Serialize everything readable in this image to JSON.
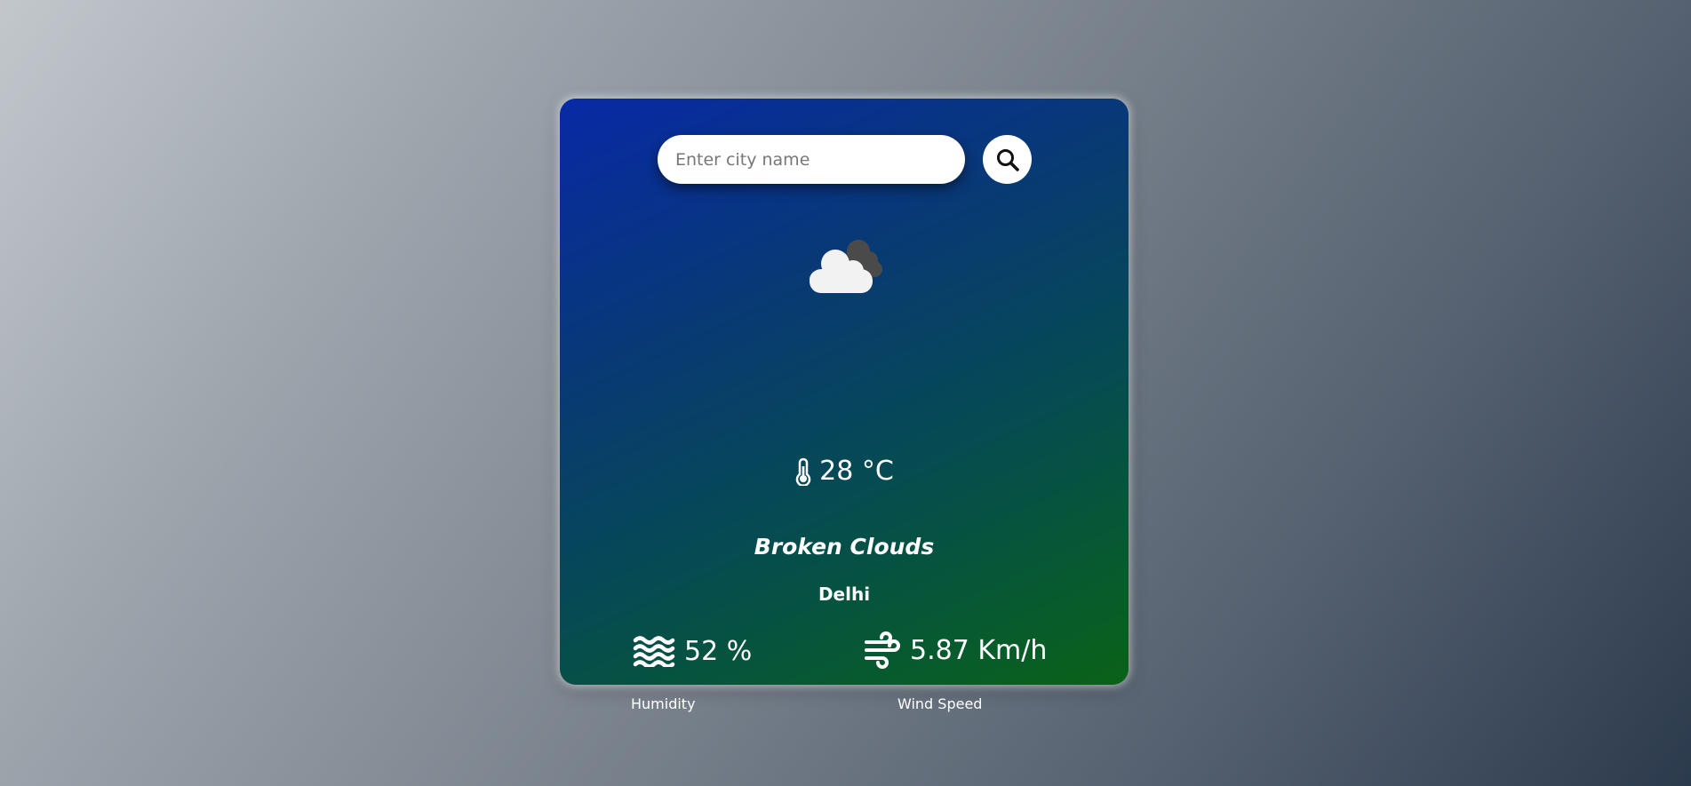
{
  "search": {
    "placeholder": "Enter city name",
    "button_icon": "search-icon"
  },
  "weather": {
    "icon": "broken-clouds-icon",
    "temperature": "28 °C",
    "temperature_icon": "thermometer-icon",
    "description": "Broken Clouds",
    "city": "Delhi"
  },
  "stats": {
    "humidity": {
      "value": "52 %",
      "label": "Humidity",
      "icon": "water-waves-icon"
    },
    "wind": {
      "value": "5.87 Km/h",
      "label": "Wind Speed",
      "icon": "wind-icon"
    }
  },
  "colors": {
    "card_gradient_start": "#0829a6",
    "card_gradient_end": "#0a6217",
    "text": "#ffffff"
  }
}
